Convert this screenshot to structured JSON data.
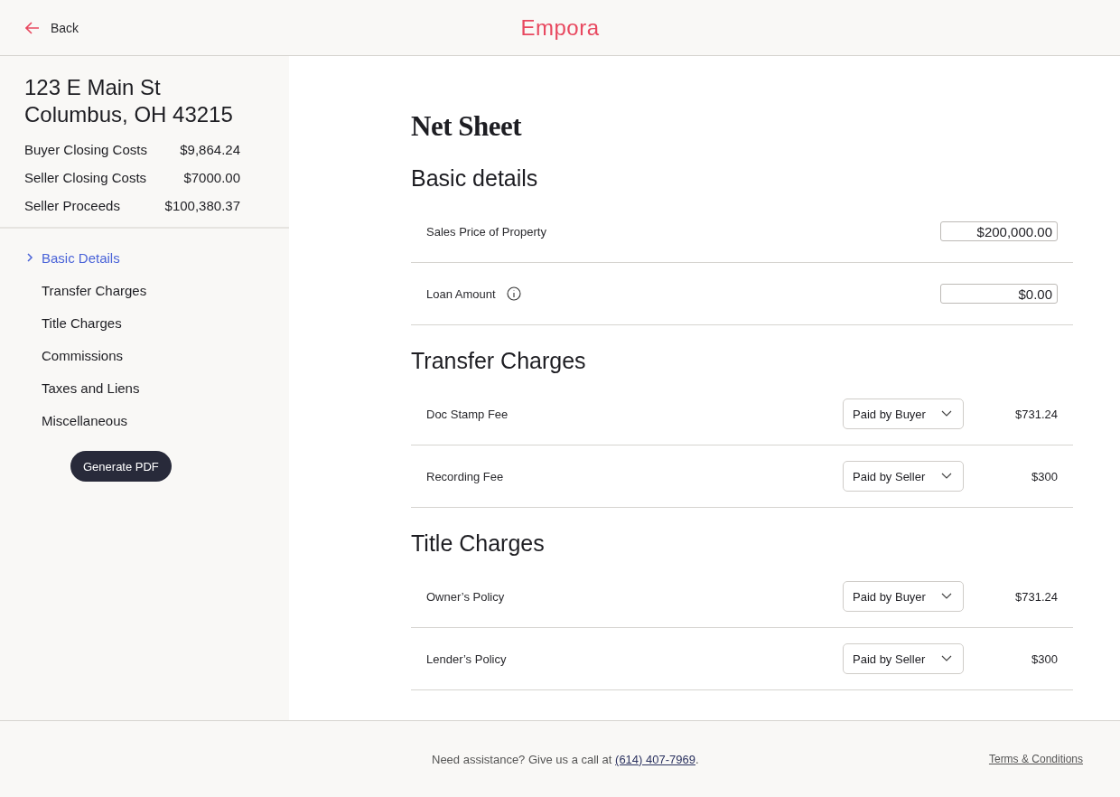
{
  "header": {
    "back": "Back",
    "logo": "Empora"
  },
  "sidebar": {
    "address": [
      "123 E Main St",
      "Columbus, OH 43215"
    ],
    "totals": [
      {
        "label": "Buyer Closing Costs",
        "value": "$9,864.24"
      },
      {
        "label": "Seller Closing Costs",
        "value": "$7000.00"
      },
      {
        "label": "Seller Proceeds",
        "value": "$100,380.37"
      }
    ],
    "nav": [
      {
        "label": "Basic Details",
        "selected": true
      },
      {
        "label": "Transfer Charges",
        "selected": false
      },
      {
        "label": "Title Charges",
        "selected": false
      },
      {
        "label": "Commissions",
        "selected": false
      },
      {
        "label": "Taxes and Liens",
        "selected": false
      },
      {
        "label": "Miscellaneous",
        "selected": false
      }
    ],
    "button": "Generate PDF"
  },
  "main": {
    "title": "Net Sheet",
    "sections": [
      {
        "heading": "Basic details",
        "rows": [
          {
            "kind": "input",
            "label": "Sales Price of Property",
            "value": "$200,000.00"
          },
          {
            "kind": "input",
            "label": "Loan Amount",
            "value": "$0.00",
            "info": true
          }
        ]
      },
      {
        "heading": "Transfer Charges",
        "rows": [
          {
            "kind": "select",
            "label": "Doc Stamp Fee",
            "option": "Paid by Buyer",
            "amount": "$731.24"
          },
          {
            "kind": "select",
            "label": "Recording Fee",
            "option": "Paid by Seller",
            "amount": "$300"
          }
        ]
      },
      {
        "heading": "Title Charges",
        "rows": [
          {
            "kind": "select",
            "label": "Owner’s Policy",
            "option": "Paid by Buyer",
            "amount": "$731.24"
          },
          {
            "kind": "select",
            "label": "Lender’s Policy",
            "option": "Paid by Seller",
            "amount": "$300"
          }
        ]
      }
    ]
  },
  "footer": {
    "text": "Need assistance? Give us a call at ",
    "phone": "(614) 407-7969",
    "end": ".",
    "terms": "Terms & Conditions"
  }
}
